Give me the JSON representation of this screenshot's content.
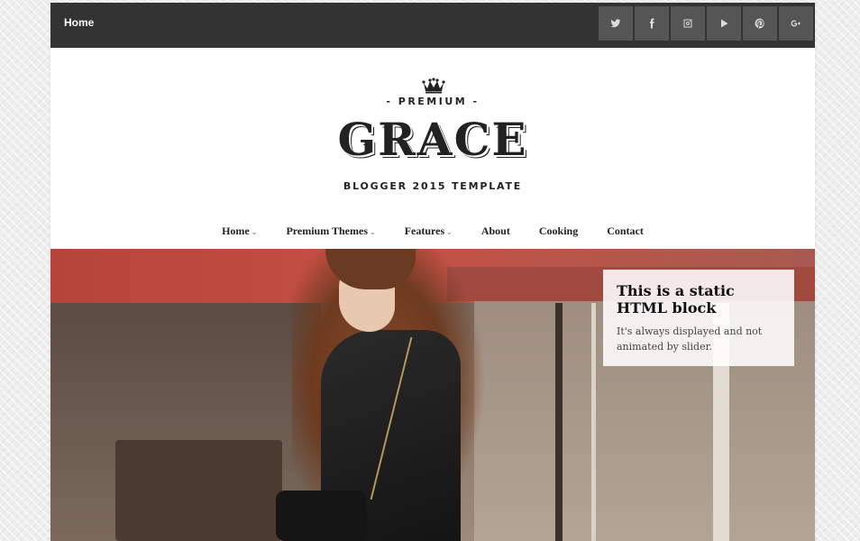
{
  "topbar": {
    "home_label": "Home",
    "social": [
      {
        "name": "twitter-icon",
        "glyph": "t"
      },
      {
        "name": "facebook-icon",
        "glyph": "f"
      },
      {
        "name": "instagram-icon",
        "glyph": "ig"
      },
      {
        "name": "youtube-icon",
        "glyph": "play"
      },
      {
        "name": "pinterest-icon",
        "glyph": "p"
      },
      {
        "name": "google-plus-icon",
        "glyph": "g+"
      }
    ]
  },
  "header": {
    "premium": "- PREMIUM -",
    "logo": "GRACE",
    "tagline": "BLOGGER 2015 TEMPLATE"
  },
  "menu": {
    "items": [
      {
        "label": "Home",
        "has_dropdown": true
      },
      {
        "label": "Premium Themes",
        "has_dropdown": true
      },
      {
        "label": "Features",
        "has_dropdown": true
      },
      {
        "label": "About",
        "has_dropdown": false
      },
      {
        "label": "Cooking",
        "has_dropdown": false
      },
      {
        "label": "Contact",
        "has_dropdown": false
      }
    ],
    "caret": "⌄"
  },
  "hero": {
    "static_block_title": "This is a static HTML block",
    "static_block_text": "It's always displayed and not animated by slider."
  },
  "colors": {
    "topbar_bg": "#333333",
    "social_button_bg": "#555555",
    "page_bg": "#ffffff",
    "text_dark": "#222222"
  }
}
